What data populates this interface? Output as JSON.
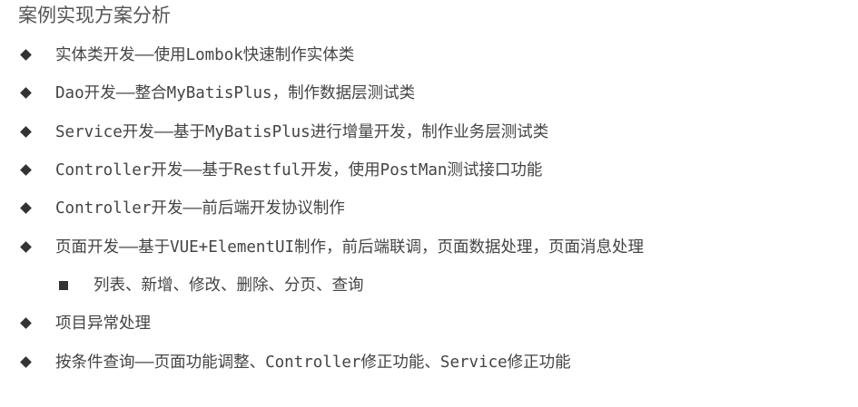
{
  "slide": {
    "title": "案例实现方案分析",
    "items": [
      {
        "text": "实体类开发——使用Lombok快速制作实体类",
        "level": 1
      },
      {
        "text": "Dao开发——整合MyBatisPlus，制作数据层测试类",
        "level": 1
      },
      {
        "text": "Service开发——基于MyBatisPlus进行增量开发，制作业务层测试类",
        "level": 1
      },
      {
        "text": "Controller开发——基于Restful开发，使用PostMan测试接口功能",
        "level": 1
      },
      {
        "text": "Controller开发——前后端开发协议制作",
        "level": 1
      },
      {
        "text": "页面开发——基于VUE+ElementUI制作，前后端联调，页面数据处理，页面消息处理",
        "level": 1
      },
      {
        "text": "列表、新增、修改、删除、分页、查询",
        "level": 2
      },
      {
        "text": "项目异常处理",
        "level": 1
      },
      {
        "text": "按条件查询——页面功能调整、Controller修正功能、Service修正功能",
        "level": 1
      }
    ]
  },
  "colors": {
    "text": "#444444",
    "title": "#555555",
    "marker": "#333333",
    "background": "#ffffff"
  },
  "icons": {
    "level1_marker": "diamond-bullet-icon",
    "level2_marker": "square-bullet-icon"
  }
}
